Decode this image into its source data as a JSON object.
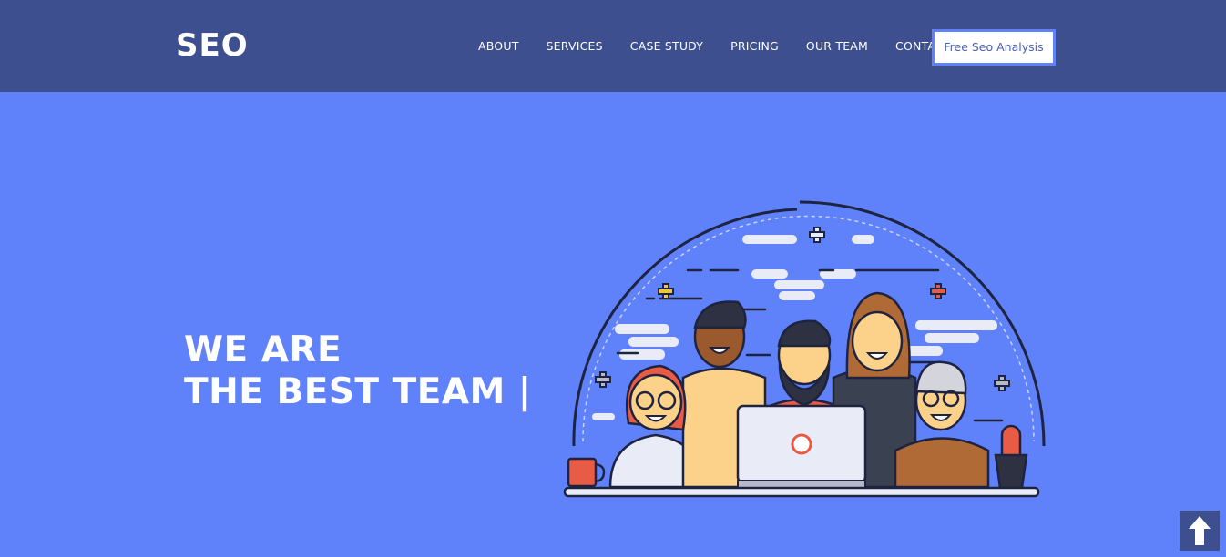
{
  "header": {
    "logo": "SEO",
    "nav": [
      {
        "label": "ABOUT"
      },
      {
        "label": "SERVICES"
      },
      {
        "label": "CASE STUDY"
      },
      {
        "label": "PRICING"
      },
      {
        "label": "OUR TEAM"
      },
      {
        "label": "CONTACT"
      }
    ],
    "cta_label": "Free Seo Analysis"
  },
  "hero": {
    "line1": "WE ARE",
    "line2": "THE BEST TEAM |"
  },
  "colors": {
    "header_bg": "#3d4f8e",
    "page_bg": "#5f82fb",
    "accent": "#5f82fb"
  },
  "icons": {
    "scroll_top": "arrow-up-icon",
    "illustration": "team-illustration"
  }
}
